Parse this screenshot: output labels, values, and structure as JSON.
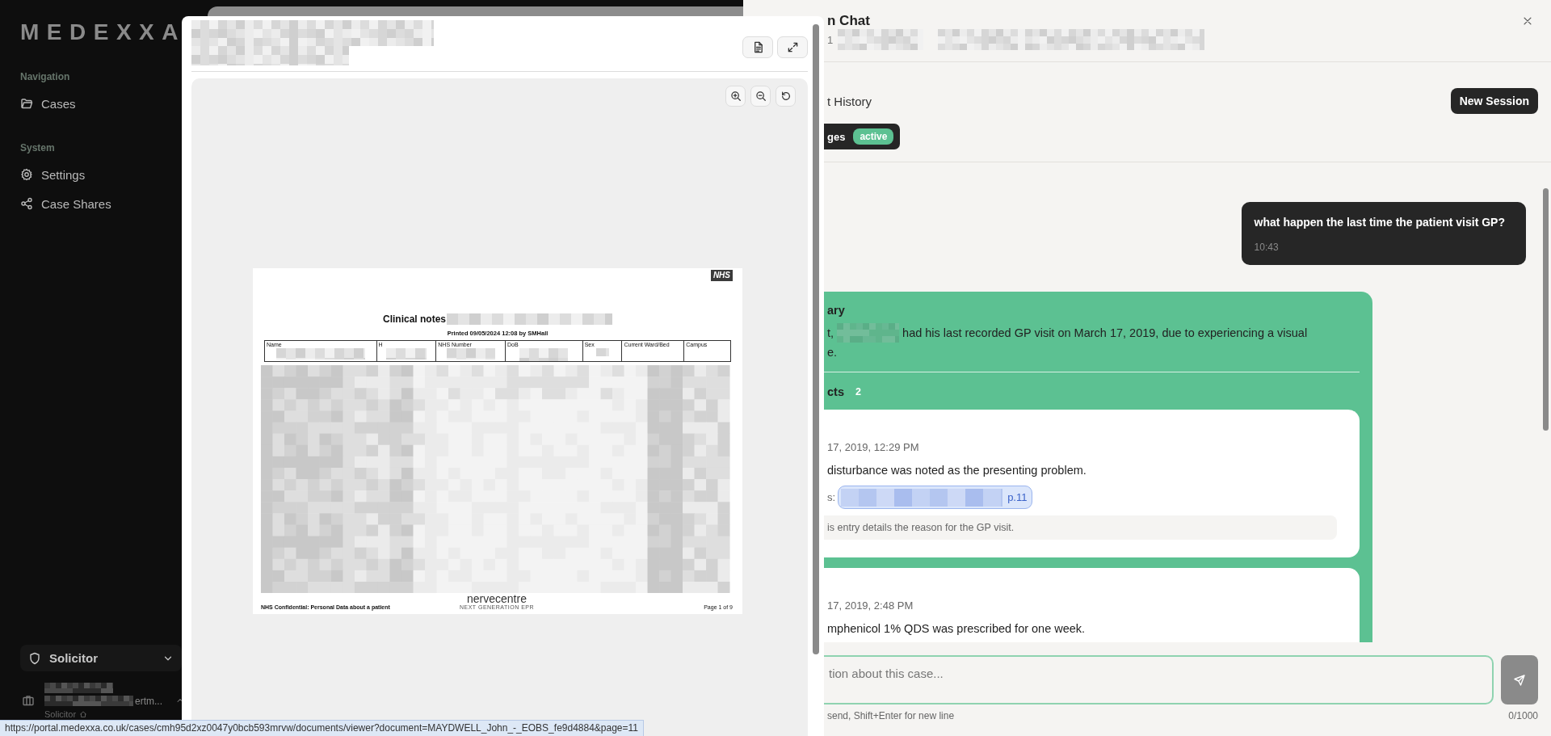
{
  "sidebar": {
    "logo": "MEDEXXA",
    "sections": [
      {
        "heading": "Navigation",
        "items": [
          {
            "label": "Cases"
          }
        ]
      },
      {
        "heading": "System",
        "items": [
          {
            "label": "Settings"
          },
          {
            "label": "Case Shares"
          }
        ]
      }
    ],
    "role_select": {
      "label": "Solicitor"
    },
    "user": {
      "name_tail": "ertm...",
      "role": "Solicitor"
    }
  },
  "document_viewer": {
    "page": {
      "logo": "NHS",
      "title": "Clinical notes",
      "printed": "Printed 09/05/2024 12:08 by SMHall",
      "columns": [
        "Name",
        "H",
        "NHS Number",
        "DoB",
        "Sex",
        "Current Ward/Bed",
        "Campus"
      ],
      "footer_left": "NHS Confidential: Personal Data about a patient",
      "brand": "nervecentre",
      "brand_tagline": "NEXT GENERATION EPR",
      "page_label": "Page 1 of 9"
    }
  },
  "chat": {
    "title": "n Chat",
    "subtitle": "1",
    "history_label": "t History",
    "new_session": "New Session",
    "session": {
      "label": "ges",
      "status": "active"
    },
    "messages": [
      {
        "kind": "user",
        "text": "what happen the last time the patient visit GP?",
        "time": "10:43"
      },
      {
        "kind": "assistant",
        "summary_heading": "ary",
        "summary": {
          "lead": "t,",
          "text": "had his last recorded GP visit on March 17, 2019, due to experiencing a visual",
          "continuation": "e."
        },
        "facts_heading": "cts",
        "facts_count": "2",
        "facts": [
          {
            "date": "17, 2019, 12:29 PM",
            "text": "disturbance was noted as the presenting problem.",
            "source_label": "s:",
            "source_page": "p.11",
            "note": "is entry details the reason for the GP visit."
          },
          {
            "date": "17, 2019, 2:48 PM",
            "text": "mphenicol 1% QDS was prescribed for one week."
          }
        ]
      }
    ],
    "input": {
      "placeholder": "tion about this case...",
      "hint": "send, Shift+Enter for new line",
      "counter": "0/1000"
    }
  },
  "status_url": "https://portal.medexxa.co.uk/cases/cmh95d2xz0047y0bcb593mrvw/documents/viewer?document=MAYDWELL_John_-_EOBS_fe9d4884&page=11"
}
